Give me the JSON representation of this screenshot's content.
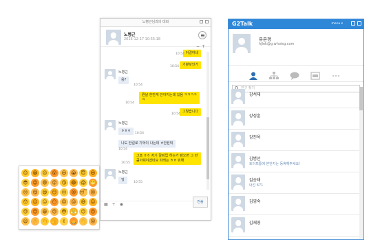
{
  "chat_window": {
    "title": "노병근님과의 대화",
    "header": {
      "name": "노병근",
      "date": "2016-12-17 10:55:18",
      "zoom_minus": "−",
      "zoom_plus": "+"
    },
    "messages": [
      {
        "type": "out",
        "text": "이걸하네",
        "time": "10:54"
      },
      {
        "type": "out",
        "text": "기분탓인가",
        "time": "10:54"
      },
      {
        "type": "in",
        "sender": "노병근",
        "text": "응?",
        "time": "10:54"
      },
      {
        "type": "out",
        "text": "뭔날 한만게 안아지는데 있음 ㅋㅋㅋㅋ ㅋ",
        "time": "10:54"
      },
      {
        "type": "out",
        "text": "그렇습니다",
        "time": "10:54"
      },
      {
        "type": "in",
        "sender": "노병근",
        "text": "ㅎㅎㅎ",
        "time": "10:54"
      },
      {
        "type": "in",
        "text": "나도 한길로 기억이 나는데 ㅎ안된되",
        "time": "10:54"
      },
      {
        "type": "out",
        "text": "그죠 ㅎㅎ 저기 칼퇴입 하는거 됐으면 그 만큼아워야겠네요 파레는 ㅎㅎ 뭐해",
        "time": "10:55"
      },
      {
        "type": "in",
        "sender": "노병근",
        "text": "엉",
        "time": "10:55"
      }
    ],
    "send_label": "전송"
  },
  "emoji_panel": {
    "emojis": [
      "😊",
      "😁",
      "😍",
      "😵",
      "😃",
      "😭",
      "😇",
      "😆",
      "😎",
      "😜",
      "😄",
      "😲",
      "😘",
      "😂",
      "😱",
      "😬",
      "😔",
      "😋",
      "😪",
      "😏",
      "😐",
      "😝",
      "😴",
      "😡",
      "😯",
      "😉",
      "😑",
      "😶",
      "😞",
      "😢",
      "😅",
      "😖",
      "😓",
      "😌",
      "😀",
      "😒",
      "😳",
      "😤",
      "😥",
      "😣",
      "😦",
      "👌",
      "👏",
      "👍",
      "✌",
      "🙏",
      "👋",
      "😲"
    ]
  },
  "g2talk": {
    "title": "G2Talk",
    "menu": "menu ▾",
    "profile": {
      "name": "유은경",
      "email": "hjlek@g.whoisg.com"
    },
    "tabs": [
      "person-icon",
      "org-icon",
      "chat-icon",
      "calendar-icon",
      "more-icon"
    ],
    "search_placeholder": "친구 찾기",
    "contacts": [
      {
        "name": "강석재",
        "status": ""
      },
      {
        "name": "강성훈",
        "status": ""
      },
      {
        "name": "강진옥",
        "status": ""
      },
      {
        "name": "김병선",
        "status": "토이프통에 본안지는 동휴해주세요!"
      },
      {
        "name": "김승태",
        "status": "내선 671"
      },
      {
        "name": "김영숙",
        "status": ""
      },
      {
        "name": "김재영",
        "status": ""
      }
    ]
  },
  "colors": {
    "accent": "#2f87d8",
    "bubble_out": "#ffe400",
    "bubble_in": "#e6ecf6"
  }
}
